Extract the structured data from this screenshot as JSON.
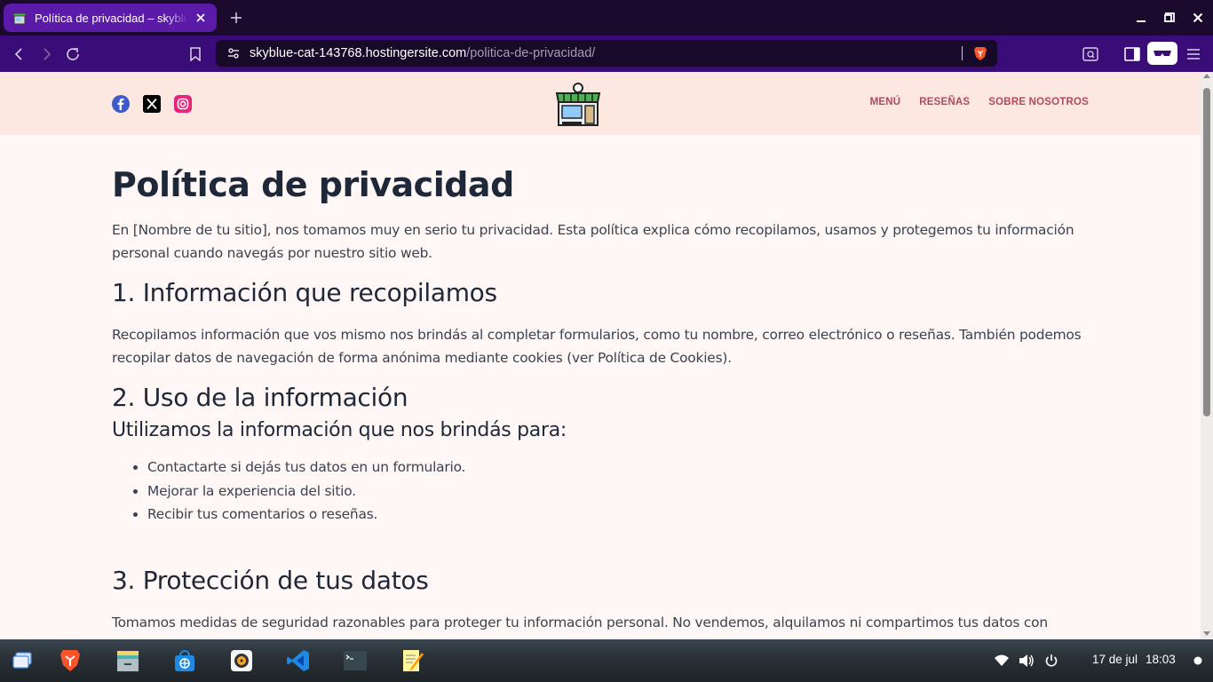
{
  "browser": {
    "tab_title": "Política de privacidad – skyblue-cat-143768.hostingersite.com",
    "url_host": "skyblue-cat-143768.hostingersite.com",
    "url_path": "/politica-de-privacidad/"
  },
  "header": {
    "social": [
      "facebook-icon",
      "x-icon",
      "instagram-icon"
    ],
    "nav": [
      {
        "label": "MENÚ"
      },
      {
        "label": "RESEÑAS"
      },
      {
        "label": "SOBRE NOSOTROS"
      }
    ]
  },
  "content": {
    "title": "Política de privacidad",
    "intro": "En [Nombre de tu sitio], nos tomamos muy en serio tu privacidad. Esta política explica cómo recopilamos, usamos y protegemos tu información personal cuando navegás por nuestro sitio web.",
    "s1_heading": "1. Información que recopilamos",
    "s1_text": "Recopilamos información que vos mismo nos brindás al completar formularios, como tu nombre, correo electrónico o reseñas. También podemos recopilar datos de navegación de forma anónima mediante cookies (ver Política de Cookies).",
    "s2_heading": "2. Uso de la información",
    "s2_sub": "Utilizamos la información que nos brindás para:",
    "s2_items": [
      "Contactarte si dejás tus datos en un formulario.",
      "Mejorar la experiencia del sitio.",
      "Recibir tus comentarios o reseñas."
    ],
    "s3_heading": "3. Protección de tus datos",
    "s3_text": "Tomamos medidas de seguridad razonables para proteger tu información personal. No vendemos, alquilamos ni compartimos tus datos con"
  },
  "taskbar": {
    "apps": [
      "show-desktop-icon",
      "brave-browser-icon",
      "file-manager-icon",
      "software-store-icon",
      "rhythmbox-icon",
      "vscode-icon",
      "terminal-icon",
      "text-editor-icon"
    ],
    "date": "17 de jul",
    "time": "18:03"
  },
  "colors": {
    "tab_active": "#5b1aa8",
    "toolbar": "#3a0c78",
    "header_bg": "#fde7e1",
    "page_bg": "#fff7f6",
    "nav_link": "#b04a5a"
  }
}
